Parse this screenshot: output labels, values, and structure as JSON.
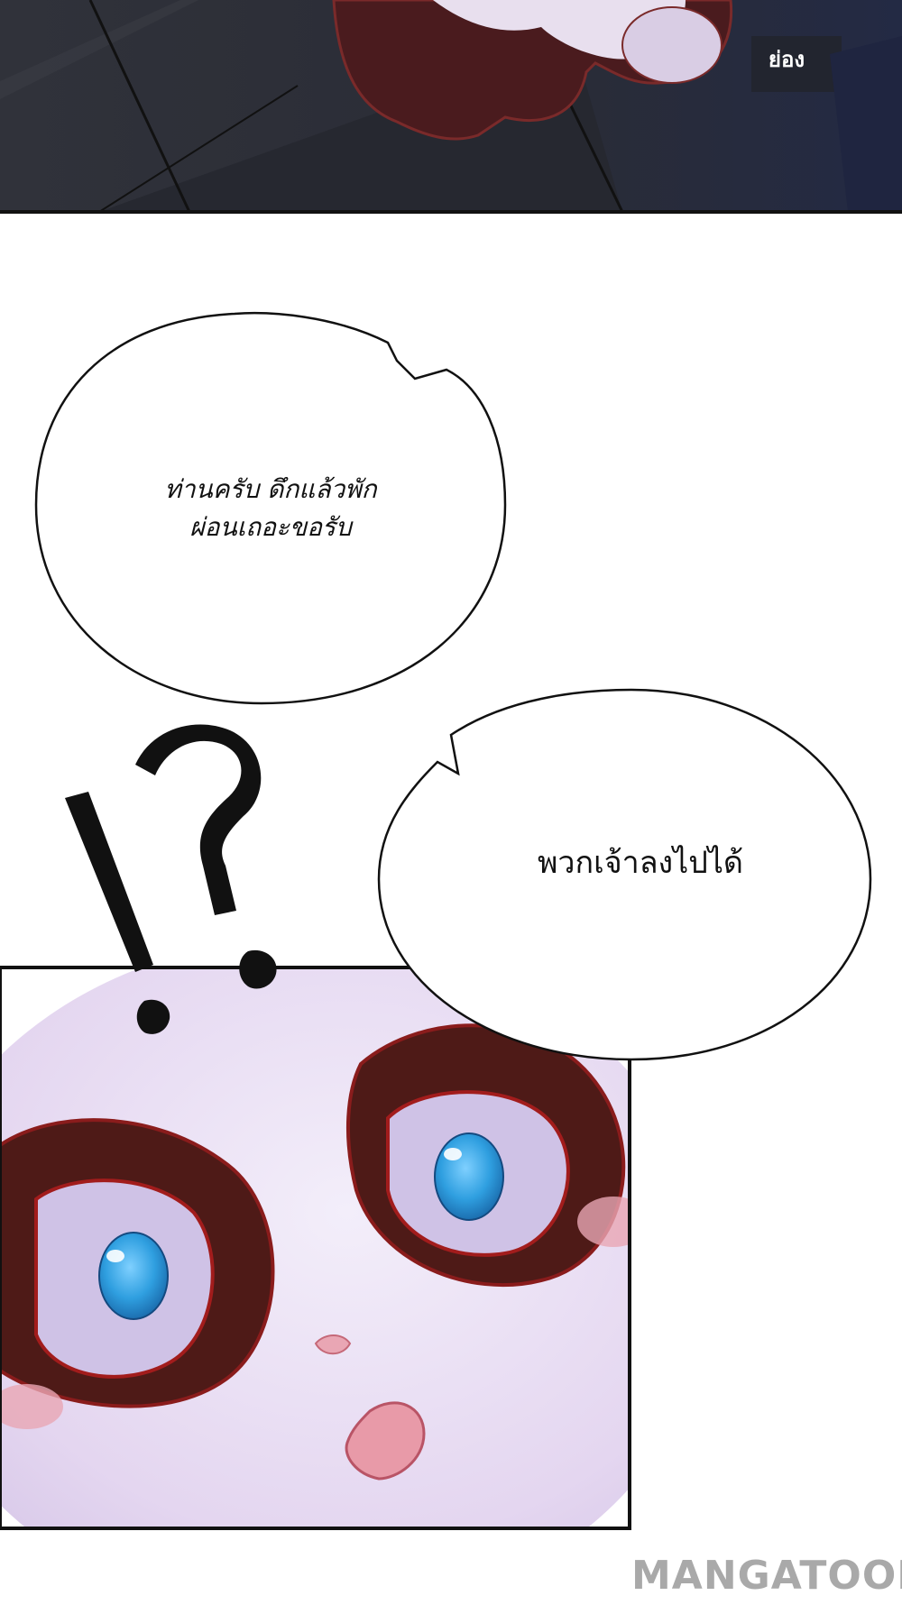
{
  "panel1": {
    "sfx_text": "ย่อง"
  },
  "bubbles": [
    {
      "lines": [
        "ท่านครับ ดึกแล้วพัก",
        "ผ่อนเถอะขอรับ"
      ]
    },
    {
      "lines": [
        "พวกเจ้าลงไปได้"
      ]
    }
  ],
  "exclamation": "!?",
  "watermark": "MANGATOON",
  "colors": {
    "night": "#2a2d38",
    "eye_iris": "#2f9fe0",
    "eye_rim": "#5a1f1a",
    "face": "#e8dcf2"
  }
}
